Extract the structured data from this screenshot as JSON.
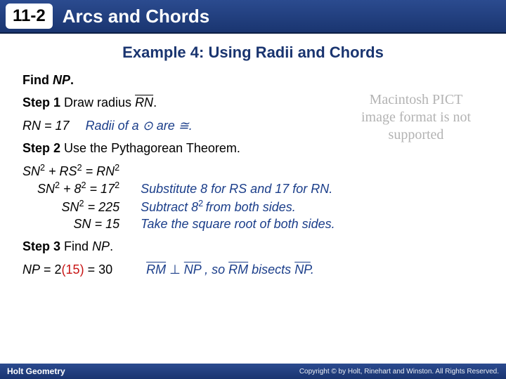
{
  "lesson_number": "11-2",
  "lesson_title": "Arcs and Chords",
  "example_title": "Example 4: Using Radii and Chords",
  "find_label": "Find ",
  "find_target": "NP",
  "step1_label": "Step 1",
  "step1_text": " Draw radius ",
  "step1_seg": "RN",
  "rn_eq": "RN = 17",
  "radii_note_prefix": "Radii of a ",
  "radii_note_suffix": " are ≅.",
  "step2_label": "Step 2",
  "step2_text": " Use the Pythagorean Theorem.",
  "eq": {
    "l1": "SN² + RS² = RN²",
    "l2": "SN² + 8² = 17²",
    "l3": "SN² = 225",
    "l4": "SN = 15"
  },
  "expl": {
    "r1": "Substitute 8 for RS and 17 for RN.",
    "r2": "Subtract 8² from both sides.",
    "r3": "Take the square root of both sides."
  },
  "step3_label": "Step 3",
  "step3_text": " Find ",
  "step3_target": "NP",
  "np_prefix": "NP",
  "np_mid": " = 2",
  "np_red": "(15)",
  "np_suffix": " = 30",
  "bisect_seg1": "RM",
  "bisect_perp": " ⊥ ",
  "bisect_seg2": "NP",
  "bisect_mid": " , so ",
  "bisect_seg3": "RM",
  "bisect_suffix": " bisects ",
  "bisect_seg4": "NP",
  "footer_brand": "Holt Geometry",
  "footer_copy": "Copyright © by Holt, Rinehart and Winston. All Rights Reserved.",
  "placeholder_text": "Macintosh PICT image format is not supported"
}
